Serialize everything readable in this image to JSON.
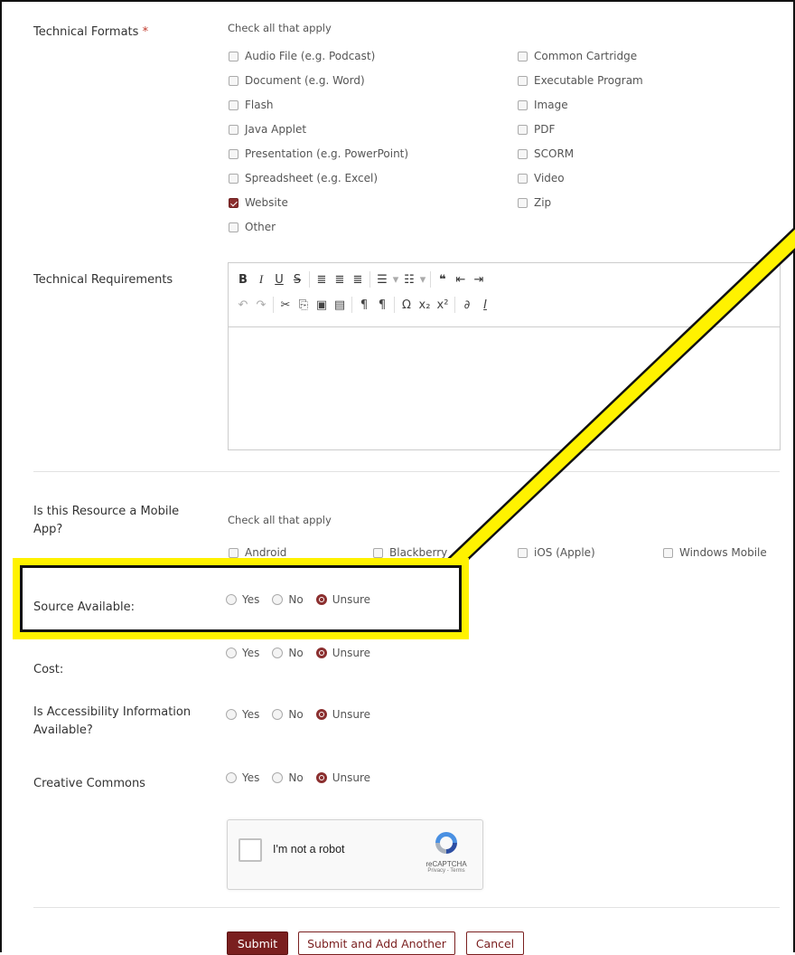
{
  "technical_formats": {
    "label": "Technical Formats",
    "required_marker": "*",
    "hint": "Check all that apply",
    "options_left": [
      {
        "label": "Audio File (e.g. Podcast)",
        "checked": false
      },
      {
        "label": "Document (e.g. Word)",
        "checked": false
      },
      {
        "label": "Flash",
        "checked": false
      },
      {
        "label": "Java Applet",
        "checked": false
      },
      {
        "label": "Presentation (e.g. PowerPoint)",
        "checked": false
      },
      {
        "label": "Spreadsheet (e.g. Excel)",
        "checked": false
      },
      {
        "label": "Website",
        "checked": true
      },
      {
        "label": "Other",
        "checked": false
      }
    ],
    "options_right": [
      {
        "label": "Common Cartridge",
        "checked": false
      },
      {
        "label": "Executable Program",
        "checked": false
      },
      {
        "label": "Image",
        "checked": false
      },
      {
        "label": "PDF",
        "checked": false
      },
      {
        "label": "SCORM",
        "checked": false
      },
      {
        "label": "Video",
        "checked": false
      },
      {
        "label": "Zip",
        "checked": false
      }
    ]
  },
  "technical_requirements": {
    "label": "Technical Requirements",
    "editor_value": "",
    "toolbar_row1": [
      "B",
      "I",
      "U",
      "S",
      "|",
      "≡",
      "≡",
      "≡",
      "|",
      "☰",
      "▾",
      "☷",
      "▾",
      "|",
      "❝",
      "⇤",
      "⇥"
    ],
    "toolbar_row2": [
      "↶",
      "↷",
      "|",
      "✂",
      "⎘",
      "📋",
      "📋",
      "|",
      "¶",
      "¶",
      "|",
      "Ω",
      "x₂",
      "x²",
      "|",
      "🔗",
      "Ix"
    ]
  },
  "mobile_app": {
    "label": "Is this Resource a Mobile App?",
    "hint": "Check all that apply",
    "options": [
      {
        "label": "Android",
        "checked": false
      },
      {
        "label": "Blackberry",
        "checked": false
      },
      {
        "label": "iOS (Apple)",
        "checked": false
      },
      {
        "label": "Windows Mobile",
        "checked": false
      }
    ]
  },
  "radio_groups": [
    {
      "key": "source",
      "label": "Source Available:",
      "options": [
        "Yes",
        "No",
        "Unsure"
      ],
      "selected": "Unsure"
    },
    {
      "key": "cost",
      "label": "Cost:",
      "options": [
        "Yes",
        "No",
        "Unsure"
      ],
      "selected": "Unsure"
    },
    {
      "key": "accessibility",
      "label": "Is Accessibility Information Available?",
      "options": [
        "Yes",
        "No",
        "Unsure"
      ],
      "selected": "Unsure"
    },
    {
      "key": "cc",
      "label": "Creative Commons",
      "options": [
        "Yes",
        "No",
        "Unsure"
      ],
      "selected": "Unsure"
    }
  ],
  "captcha": {
    "label": "I'm not a robot",
    "brand": "reCAPTCHA",
    "links": "Privacy - Terms"
  },
  "buttons": {
    "submit": "Submit",
    "submit_add": "Submit and Add Another",
    "cancel": "Cancel"
  },
  "colors": {
    "accent": "#7a1f1f",
    "highlight": "#fff200"
  }
}
